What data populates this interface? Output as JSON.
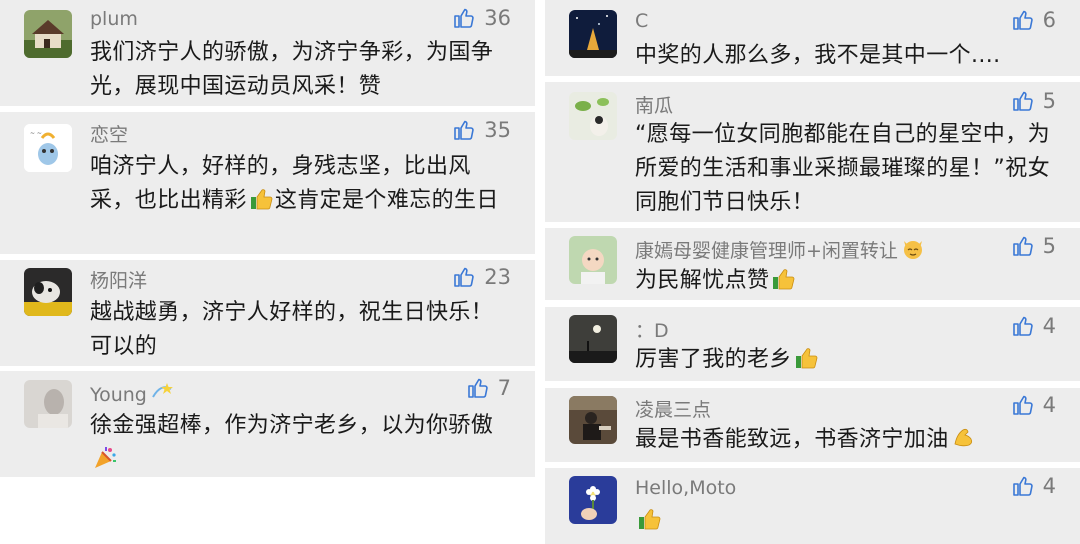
{
  "left": [
    {
      "name": "plum",
      "likes": "36",
      "text": "我们济宁人的骄傲，为济宁争彩，为国争光，展现中国运动员风采！赞",
      "avatar_icon": "house-photo-avatar"
    },
    {
      "name": "恋空",
      "likes": "35",
      "text": "咱济宁人，好样的，身残志坚，比出风采，也比出精彩",
      "text2": "这肯定是个难忘的生日",
      "emoji": "thumbs-up-emoji",
      "avatar_icon": "cartoon-bird-avatar"
    },
    {
      "name": "杨阳洋",
      "likes": "23",
      "text": "越战越勇，济宁人好样的，祝生日快乐！可以的",
      "avatar_icon": "dog-photo-avatar"
    },
    {
      "name": "Young",
      "name_emoji": "dizzy-emoji",
      "likes": "7",
      "text": "徐金强超棒，作为济宁老乡，以为你骄傲",
      "emoji": "party-popper-emoji",
      "avatar_icon": "person-photo-avatar"
    }
  ],
  "right": [
    {
      "name": "C",
      "likes": "6",
      "text": "中奖的人那么多，我不是其中一个....",
      "avatar_icon": "starry-night-avatar"
    },
    {
      "name": "南瓜",
      "likes": "5",
      "text": "“愿每一位女同胞都能在自己的星空中，为所爱的生活和事业采撷最璀璨的星！”祝女同胞们节日快乐！",
      "avatar_icon": "plant-photo-avatar"
    },
    {
      "name": "康嫣母婴健康管理师+闲置转让",
      "name_emoji": "cat-face-emoji",
      "likes": "5",
      "text": "为民解忧点赞",
      "emoji": "thumbs-up-emoji",
      "avatar_icon": "baby-photo-avatar"
    },
    {
      "name": "：D",
      "likes": "4",
      "text": "厉害了我的老乡",
      "emoji": "thumbs-up-emoji",
      "avatar_icon": "moon-night-avatar"
    },
    {
      "name": "凌晨三点",
      "likes": "4",
      "text": "最是书香能致远，书香济宁加油",
      "emoji": "flexed-biceps-emoji",
      "avatar_icon": "reading-person-avatar"
    },
    {
      "name": "Hello,Moto",
      "likes": "4",
      "text": "",
      "emoji": "thumbs-up-emoji",
      "avatar_icon": "flower-hand-avatar"
    }
  ]
}
